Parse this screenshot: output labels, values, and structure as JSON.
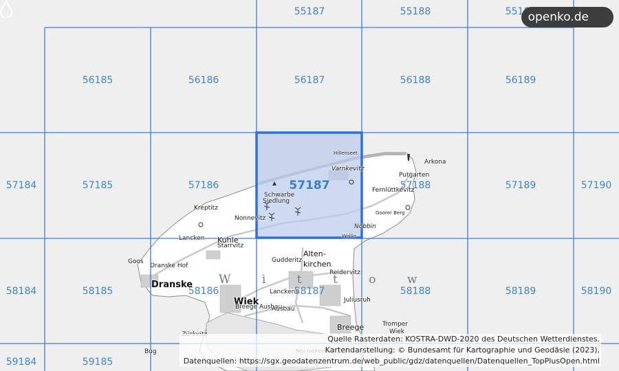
{
  "brand": {
    "logo_text": "openko.de"
  },
  "selected_cell": "57187",
  "grid": {
    "rows": [
      {
        "cells": [
          "55187",
          "55188",
          "55189"
        ]
      },
      {
        "cells": [
          "56185",
          "56186",
          "56187",
          "56188",
          "56189"
        ]
      },
      {
        "cells": [
          "57184",
          "57185",
          "57186",
          "57187",
          "57188",
          "57189",
          "57190"
        ]
      },
      {
        "cells": [
          "58184",
          "58185",
          "58186",
          "58187",
          "58188",
          "58189",
          "58190"
        ]
      },
      {
        "cells": [
          "59184",
          "59185"
        ]
      }
    ]
  },
  "places": [
    "Hillenseet",
    "Varnkevitz",
    "Arkona",
    "Putgarten",
    "Fernlüttkevitz",
    "Schwarbe",
    "Siedlung",
    "Goorer Berg",
    "Nobbin",
    "Wollin",
    "Kreptitz",
    "Nonnevitz",
    "Lancken",
    "Kuhle",
    "Starrvitz",
    "Goos",
    "Dranske Hof",
    "Dranske",
    "Gudderitz",
    "Alten-",
    "kirchen",
    "Reidervitz",
    "W i t t o w",
    "Lanckens",
    "Wiek",
    "Juliusruh",
    "Breege Ausbau",
    "Ausbau",
    "Breege",
    "Tromper",
    "Wiek",
    "Zürkvitz",
    "Bug",
    "Neu Lobkevitz"
  ],
  "attribution": [
    "Quelle Rasterdaten: KOSTRA-DWD-2020 des Deutschen Wetterdienstes.",
    "Kartendarstellung: © Bundesamt für Kartographie und Geodäsie (2023),",
    "Datenquellen: https://sgx.geodatenzentrum.de/web_public/gdz/datenquellen/Datenquellen_TopPlusOpen.html"
  ],
  "colors": {
    "grid_line": "#3b7dd8",
    "selection_fill": "#b9c9ec",
    "selection_border": "#2f6fe0",
    "land": "#ffffff",
    "sea": "#efefef",
    "logo_bg": "#3d3d3d"
  },
  "icons": [
    "drop-icon",
    "windmill-icon",
    "lighthouse-icon",
    "viewpoint-icon"
  ]
}
